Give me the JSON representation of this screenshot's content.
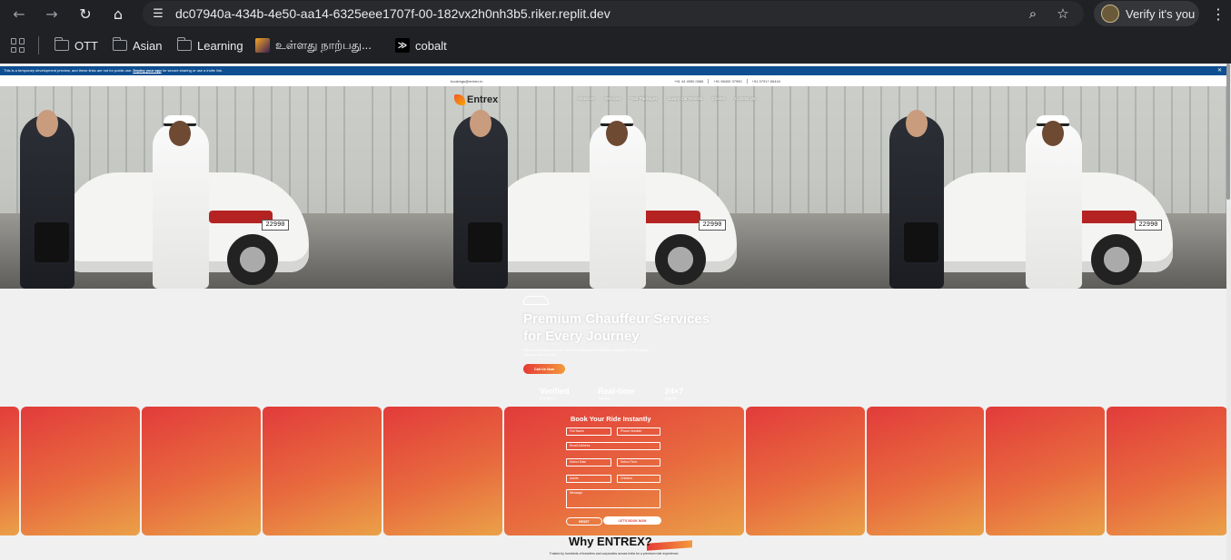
{
  "browser": {
    "url": "dc07940a-434b-4e50-aa14-6325eee1707f-00-182vx2h0nh3b5.riker.replit.dev",
    "profile_label": "Verify it's you",
    "bookmarks": [
      {
        "label": "OTT",
        "icon": "folder-icon"
      },
      {
        "label": "Asian",
        "icon": "folder-icon"
      },
      {
        "label": "Learning",
        "icon": "folder-icon"
      },
      {
        "label": "உள்ளது நாற்பது...",
        "icon": "image-favicon"
      },
      {
        "label": "cobalt",
        "icon": "cobalt-favicon"
      }
    ]
  },
  "dev_banner": {
    "text": "This is a temporary development preview, and these links are not for public use.",
    "link": "Deploy your app",
    "text_after": "for secure sharing or use a invite link."
  },
  "topinfo": {
    "email": "bookings@entrex.in",
    "phones": [
      "+91 44 4950 0066",
      "+91 98400 37990",
      "+91 97917 65444"
    ]
  },
  "site": {
    "logo_text": "Entrex",
    "nav": [
      "About Us",
      "Services",
      "Tour Packages",
      "Luxury Car Rentals",
      "Clients",
      "Contact Us"
    ],
    "plate_text": "22990",
    "hero": {
      "title": "Premium Chauffeur Services for Every Journey",
      "subtitle": "Enjoy comfortable and safe rides with professional chauffeurs, available 24/7 for airport transfers and city travel.",
      "cta": "Call Us Now",
      "stats": [
        {
          "value": "Verified",
          "label": "Chauffeurs"
        },
        {
          "value": "Real-time",
          "label": "Tracking"
        },
        {
          "value": "24×7",
          "label": "Support"
        }
      ]
    },
    "booking": {
      "title": "Book Your Ride Instantly",
      "full_name": "Full Name",
      "phone": "Phone Number",
      "email": "Email Address",
      "date": "Select Date",
      "time": "Select Time",
      "adults": "Adults",
      "children": "Children",
      "message": "Message",
      "reset": "RESET",
      "submit": "LET'S BOOK NOW"
    },
    "why": {
      "title": "Why ENTREX?",
      "subtitle": "Trusted by hundreds of travelers and corporates across India for a premium ride experience."
    }
  }
}
